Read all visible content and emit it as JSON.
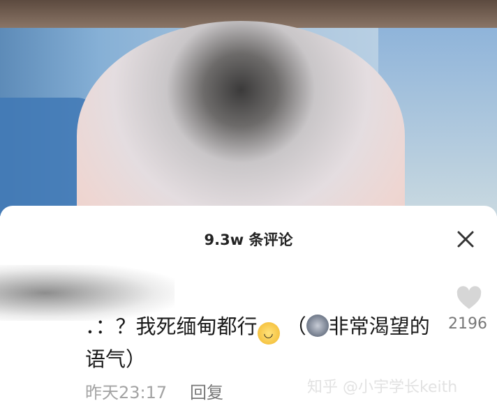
{
  "header": {
    "title": "9.3w 条评论"
  },
  "comment": {
    "text_before": "．：？我死缅甸都行",
    "emoji1": "smile-emoji",
    "text_middle": "（",
    "emoji2": "wolf-emoji",
    "text_after": "非常渴望的语气）",
    "likes": "2196",
    "time": "昨天23:17",
    "reply": "回复"
  },
  "watermark": "知乎 @小宇学长keith"
}
